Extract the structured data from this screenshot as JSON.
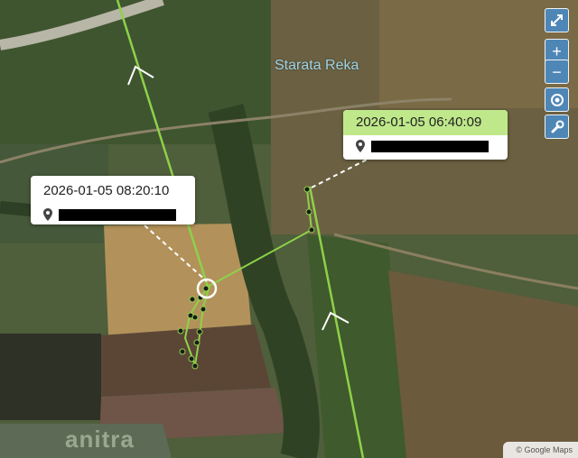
{
  "map": {
    "place_label": "Starata Reka",
    "attribution": "© Google Maps",
    "logo_text": "anitra"
  },
  "controls": {
    "fullscreen": "expand-icon",
    "zoom_in": "+",
    "zoom_out": "−",
    "locate": "target-icon",
    "settings": "wrench-icon"
  },
  "popups": {
    "left": {
      "timestamp": "2026-01-05 08:20:10",
      "location": "[redacted]"
    },
    "right": {
      "timestamp": "2026-01-05 06:40:09",
      "location": "[redacted]"
    }
  },
  "colors": {
    "track": "#8ed14a",
    "popup_header_highlight": "#bfe88a",
    "control_bg": "#4e86b6",
    "label": "#9fd3e6"
  }
}
